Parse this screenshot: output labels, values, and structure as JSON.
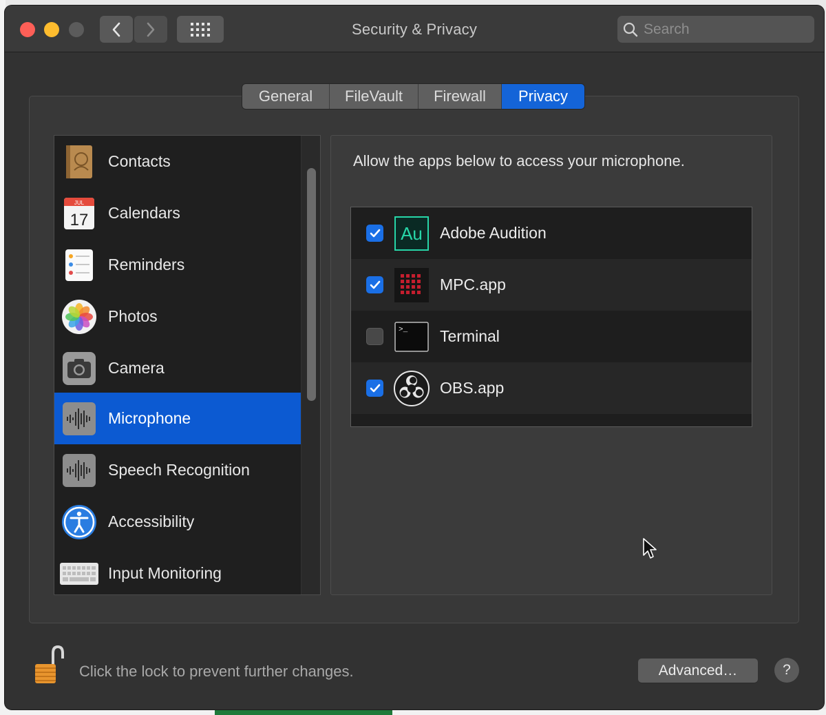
{
  "window": {
    "title": "Security & Privacy"
  },
  "toolbar": {
    "search_placeholder": "Search"
  },
  "tabs": [
    {
      "label": "General",
      "active": false
    },
    {
      "label": "FileVault",
      "active": false
    },
    {
      "label": "Firewall",
      "active": false
    },
    {
      "label": "Privacy",
      "active": true
    }
  ],
  "sidebar": {
    "items": [
      {
        "label": "Contacts",
        "icon": "contacts-icon"
      },
      {
        "label": "Calendars",
        "icon": "calendar-icon",
        "icon_text_month": "JUL",
        "icon_text_day": "17"
      },
      {
        "label": "Reminders",
        "icon": "reminders-icon"
      },
      {
        "label": "Photos",
        "icon": "photos-icon"
      },
      {
        "label": "Camera",
        "icon": "camera-icon"
      },
      {
        "label": "Microphone",
        "icon": "microphone-icon",
        "selected": true
      },
      {
        "label": "Speech Recognition",
        "icon": "speech-recognition-icon"
      },
      {
        "label": "Accessibility",
        "icon": "accessibility-icon"
      },
      {
        "label": "Input Monitoring",
        "icon": "keyboard-icon"
      }
    ]
  },
  "detail": {
    "description": "Allow the apps below to access your microphone.",
    "apps": [
      {
        "name": "Adobe Audition",
        "checked": true,
        "icon": "adobe-audition-icon",
        "icon_text": "Au"
      },
      {
        "name": "MPC.app",
        "checked": true,
        "icon": "mpc-icon"
      },
      {
        "name": "Terminal",
        "checked": false,
        "icon": "terminal-icon",
        "icon_text": ">_"
      },
      {
        "name": "OBS.app",
        "checked": true,
        "icon": "obs-icon"
      }
    ]
  },
  "footer": {
    "lock_message": "Click the lock to prevent further changes.",
    "advanced_label": "Advanced…",
    "help_label": "?"
  },
  "colors": {
    "accent": "#0c5ad2",
    "checkbox_on": "#1a6fe6",
    "window_bg": "#323232"
  }
}
